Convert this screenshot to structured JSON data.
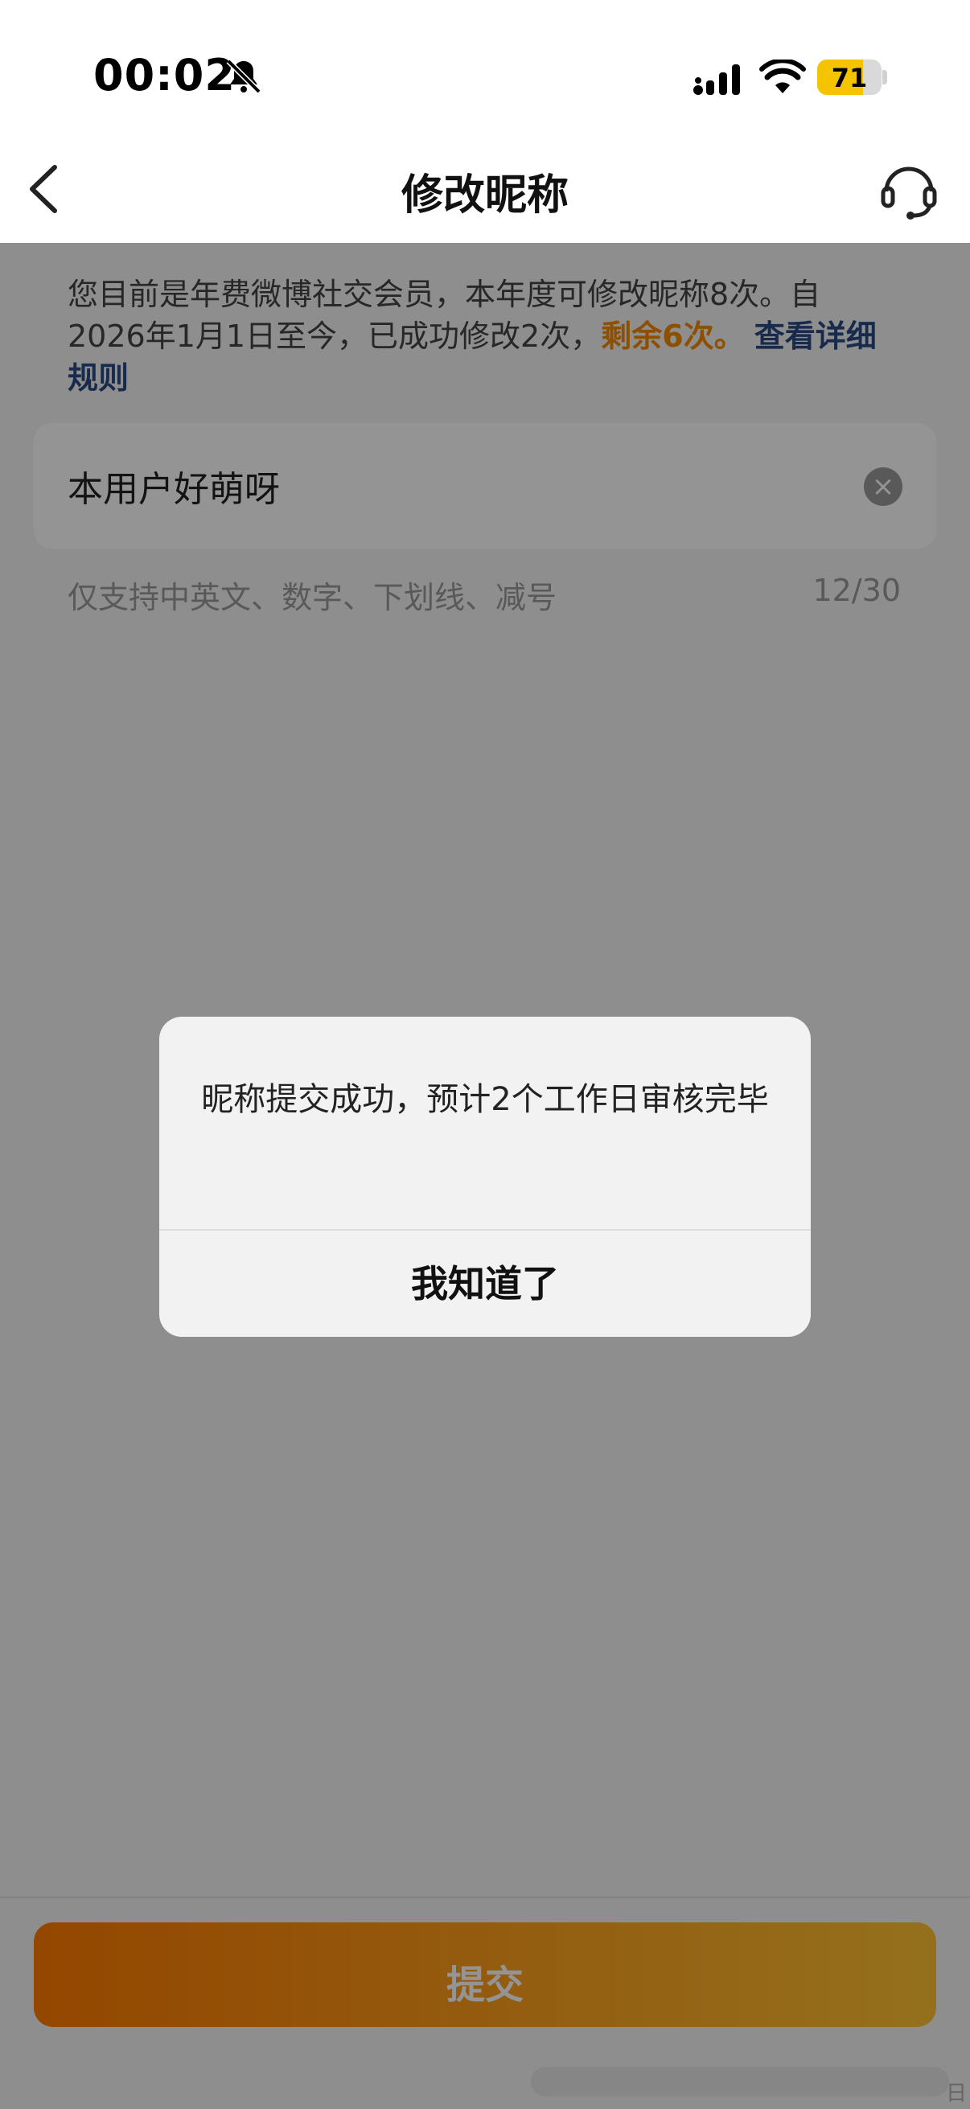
{
  "status_bar": {
    "time": "00:02",
    "battery": "71",
    "battery_level": 0.71,
    "icons": [
      "bell-slash-icon",
      "signal-icon",
      "wifi-icon",
      "battery-icon"
    ]
  },
  "nav": {
    "title": "修改昵称",
    "icons": [
      "chevron-left-icon",
      "headset-icon"
    ]
  },
  "notice": {
    "text": "您目前是年费微博社交会员，本年度可修改昵称8次。自2026年1月1日至今，已成功修改2次，",
    "highlight": "剩余6次。",
    "link": "查看详细规则"
  },
  "name_input": {
    "value": "本用户好萌呀"
  },
  "hint": {
    "text": "仅支持中英文、数字、下划线、减号",
    "count": "12/30"
  },
  "submit": {
    "label": "提交"
  },
  "dialog": {
    "message": "昵称提交成功，预计2个工作日审核完毕",
    "button": "我知道了"
  },
  "colors": {
    "accent_orange": "#f38a00",
    "link_blue": "#2a4a86",
    "battery_yellow": "#f5c400"
  },
  "watermark_glyph": "日"
}
